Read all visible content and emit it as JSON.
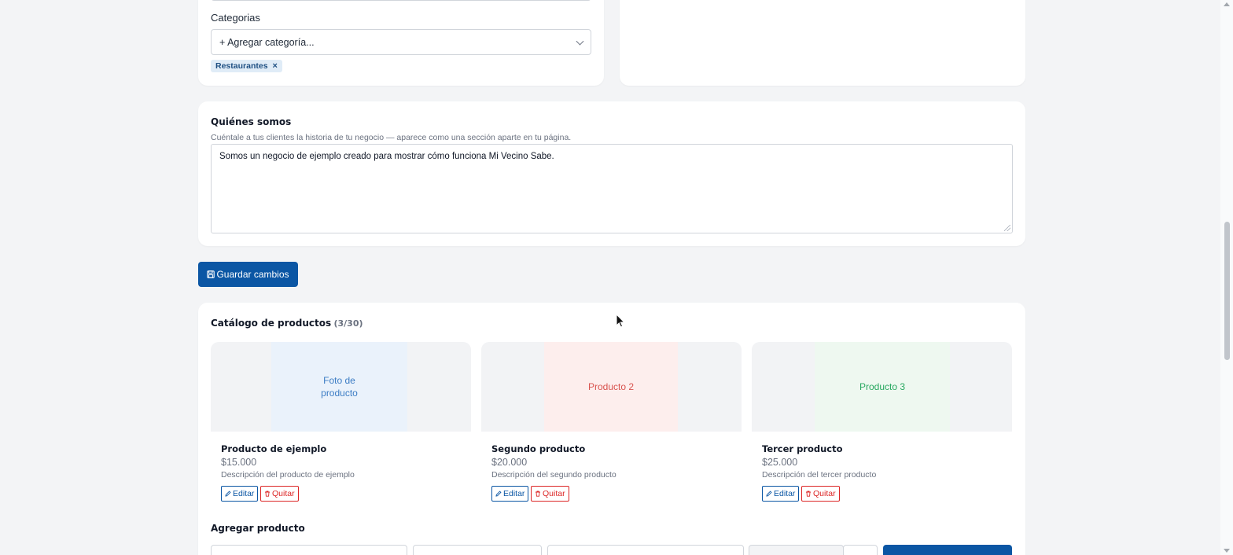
{
  "details_card": {
    "categories_label": "Categorias",
    "category_select_placeholder": "+ Agregar categoría...",
    "selected_tags": [
      {
        "label": "Restaurantes",
        "remove": "×"
      }
    ]
  },
  "about": {
    "title": "Quiénes somos",
    "hint": "Cuéntale a tus clientes la historia de tu negocio — aparece como una sección aparte en tu página.",
    "text": "Somos un negocio de ejemplo creado para mostrar cómo funciona Mi Vecino Sabe."
  },
  "save_button": {
    "label": "Guardar cambios",
    "icon": "save-icon"
  },
  "catalog": {
    "title": "Catálogo de productos",
    "count": "(3/30)",
    "edit_label": "Editar",
    "remove_label": "Quitar",
    "products": [
      {
        "placeholder": "Foto de producto",
        "name": "Producto de ejemplo",
        "price": "$15.000",
        "description": "Descripción del producto de ejemplo",
        "tint": "#eaf2fb",
        "text_color": "#3b7cc4"
      },
      {
        "placeholder": "Producto 2",
        "name": "Segundo producto",
        "price": "$20.000",
        "description": "Descripción del segundo producto",
        "tint": "#fdeeed",
        "text_color": "#d9534f"
      },
      {
        "placeholder": "Producto 3",
        "name": "Tercer producto",
        "price": "$25.000",
        "description": "Descripción del tercer producto",
        "tint": "#eef8f0",
        "text_color": "#28a860"
      }
    ]
  },
  "add_product": {
    "title": "Agregar producto"
  },
  "colors": {
    "primary": "#0b56a4",
    "danger": "#dc2626",
    "page_bg": "#f3f4f6"
  }
}
